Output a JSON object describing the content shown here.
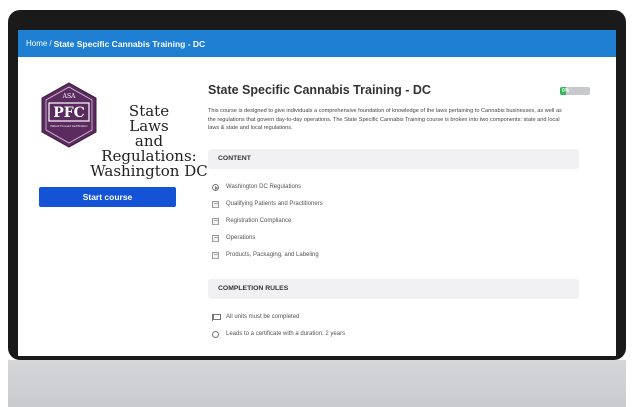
{
  "breadcrumb": {
    "home": "Home",
    "separator": "/",
    "current": "State Specific Cannabis Training - DC"
  },
  "logo": {
    "badge_top": "ASA",
    "badge_main": "PFC",
    "badge_sub": "Patient Focused Certification",
    "title_lines": [
      "State",
      "Laws",
      "and",
      "Regulations:",
      "Washington DC"
    ]
  },
  "sidebar": {
    "start_label": "Start course"
  },
  "course": {
    "title": "State Specific Cannabis Training - DC",
    "progress_label": "0%",
    "progress_value": 0,
    "description": "This course is designed to give individuals a comprehensive foundation of knowledge of the laws pertaining to Cannabis businesses, as well as the regulations that govern day-to-day operations. The State Specific Cannabis Training course is broken into two components: state and local laws & state and local regulations."
  },
  "content": {
    "heading": "CONTENT",
    "units": [
      {
        "label": "Washington DC Regulations",
        "icon": "play-circle-icon"
      },
      {
        "label": "Qualifying Patients and Practitioners",
        "icon": "document-icon"
      },
      {
        "label": "Registration Compliance",
        "icon": "document-icon"
      },
      {
        "label": "Operations",
        "icon": "document-icon"
      },
      {
        "label": "Products, Packaging, and Labeling",
        "icon": "document-icon"
      }
    ]
  },
  "completion": {
    "heading": "COMPLETION RULES",
    "rules": [
      {
        "label": "All units must be completed",
        "icon": "flag-icon"
      },
      {
        "label": "Leads to a certificate with a duration: 2 years",
        "icon": "certificate-circle-icon"
      }
    ]
  },
  "colors": {
    "topbar": "#1e7fd3",
    "button": "#1553d6",
    "progress": "#35b559",
    "badge": "#5b2a5e"
  }
}
